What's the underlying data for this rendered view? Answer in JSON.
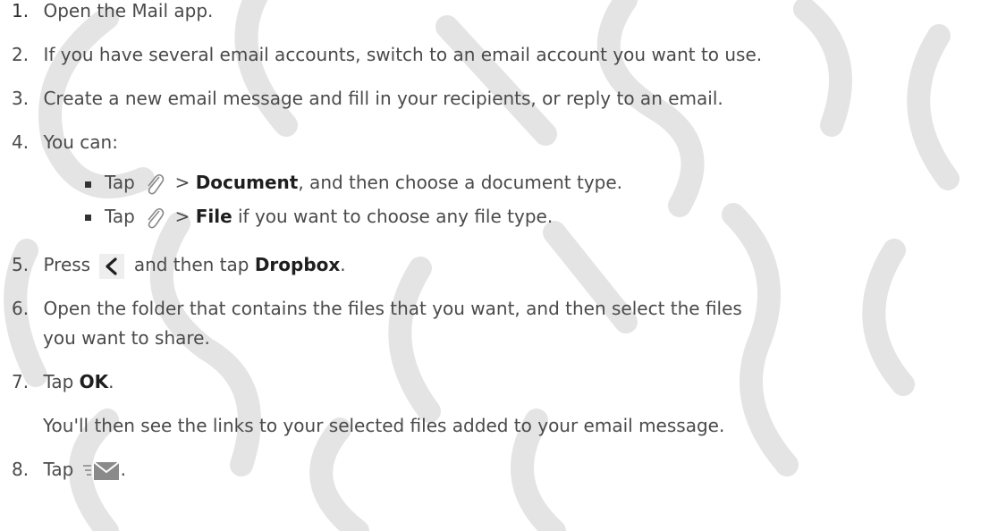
{
  "steps": [
    {
      "n": "1.",
      "text": "Open the Mail app."
    },
    {
      "n": "2.",
      "text": "If you have several email accounts, switch to an email account you want to use."
    },
    {
      "n": "3.",
      "text": "Create a new email message and fill in your recipients, or reply to an email."
    },
    {
      "n": "4.",
      "text": "You can:"
    },
    {
      "n": "5.",
      "pre": "Press",
      "mid": "and then tap",
      "em": "Dropbox",
      "post": "."
    },
    {
      "n": "6.",
      "line1": "Open the folder that contains the files that you want, and then select the files",
      "line2": "you want to share."
    },
    {
      "n": "7.",
      "pre": "Tap",
      "em": "OK",
      "post": "."
    },
    {
      "n": "8.",
      "pre": "Tap",
      "post": "."
    }
  ],
  "sub_items": [
    {
      "pre": "Tap",
      "gt": ">",
      "em": "Document",
      "post": ", and then choose a document type."
    },
    {
      "pre": "Tap",
      "gt": ">",
      "em": "File",
      "post": " if you want to choose any file type."
    }
  ],
  "note": "You'll then see the links to your selected files added to your email message.",
  "watermark_words": [
    "Certified",
    "Confidential",
    "Certification",
    "FCC",
    "Certified"
  ],
  "icons": {
    "attach": "paperclip-icon",
    "back": "back-chevron-icon",
    "send": "send-mail-icon"
  },
  "colors": {
    "text": "#4a4a4a",
    "emphasis": "#1e1e1e",
    "watermark": "#dcdcdc"
  }
}
